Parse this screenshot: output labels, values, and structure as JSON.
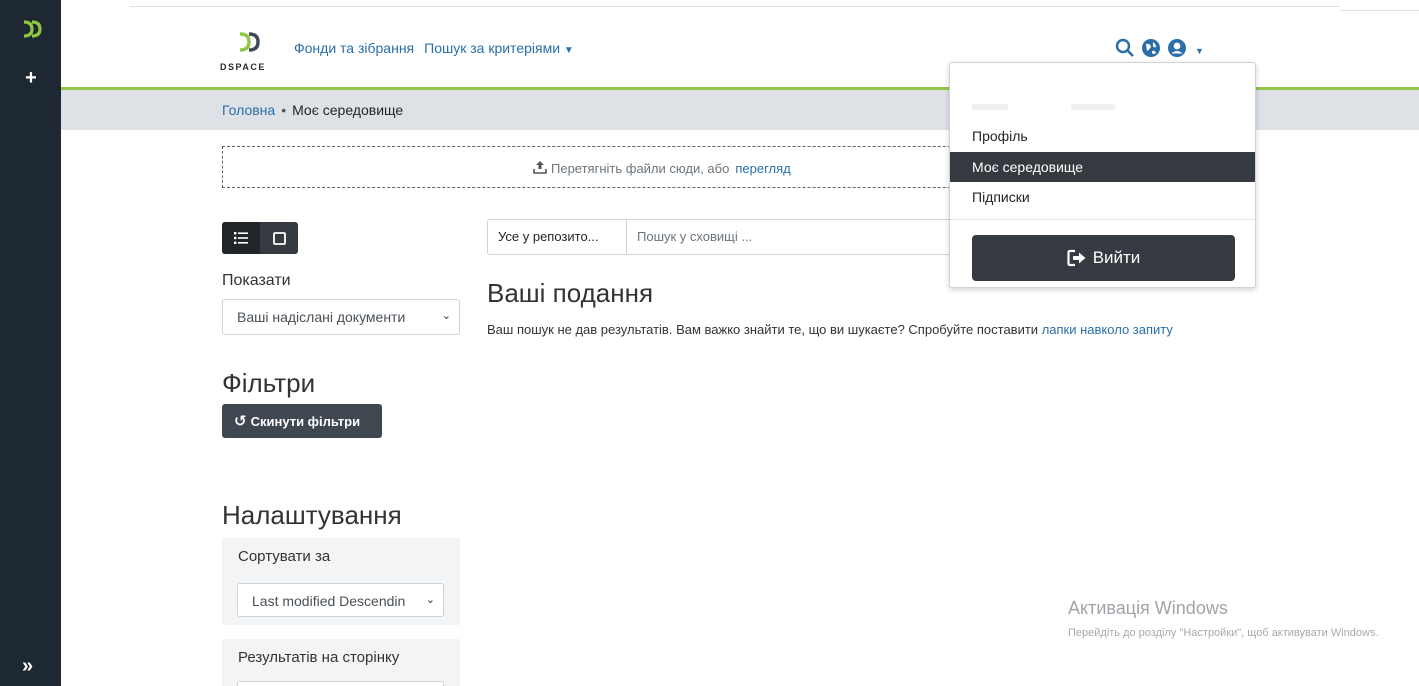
{
  "header": {
    "logo_text": "DSPACE",
    "nav": [
      {
        "label": "Фонди та зібрання"
      },
      {
        "label": "Пошук за критеріями"
      }
    ],
    "icons": [
      "search-icon",
      "globe-icon",
      "user-icon",
      "caret-down-icon"
    ]
  },
  "breadcrumb": {
    "home": "Головна",
    "separator": "•",
    "current": "Моє середовище"
  },
  "dropzone": {
    "text": "Перетягніть файли сюди, або",
    "link": "перегляд"
  },
  "sidebar": {
    "show_label": "Показати",
    "show_value": "Ваші надіслані документи",
    "filters_heading": "Фільтри",
    "reset_button": "Скинути фільтри",
    "settings_heading": "Налаштування",
    "sort_label": "Сортувати за",
    "sort_value": "Last modified Descendin",
    "rpp_label": "Результатів на сторінку"
  },
  "search": {
    "scope": "Усе у репозито...",
    "placeholder": "Пошук у сховищі ..."
  },
  "results": {
    "title": "Ваші подання",
    "message": "Ваш пошук не дав результатів. Вам важко знайти те, що ви шукаєте? Спробуйте поставити",
    "message_link": "лапки навколо запиту"
  },
  "user_menu": {
    "items": [
      {
        "label": "Профіль"
      },
      {
        "label": "Моє середовище",
        "active": true
      },
      {
        "label": "Підписки"
      }
    ],
    "logout": "Вийти"
  },
  "watermark": {
    "title": "Активація Windows",
    "subtitle": "Перейдіть до розділу \"Настройки\", щоб активувати Windows."
  },
  "colors": {
    "accent_green": "#92c642",
    "dark": "#343a40",
    "link": "#2a6fa8",
    "rail": "#1e2832"
  }
}
